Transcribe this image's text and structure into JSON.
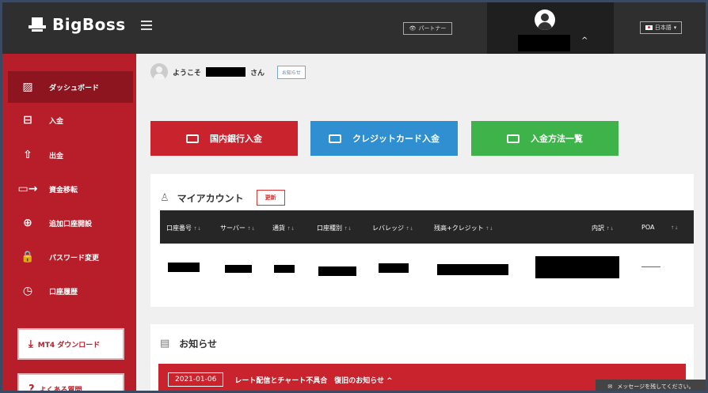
{
  "header": {
    "brand": "BigBoss",
    "partner_label": "パートナー",
    "language_label": "日本語"
  },
  "sidebar": {
    "items": [
      {
        "label": "ダッシュボード",
        "icon": "chart-icon"
      },
      {
        "label": "入金",
        "icon": "deposit-icon"
      },
      {
        "label": "出金",
        "icon": "withdraw-icon"
      },
      {
        "label": "資金移転",
        "icon": "transfer-icon"
      },
      {
        "label": "追加口座開設",
        "icon": "add-account-icon"
      },
      {
        "label": "パスワード変更",
        "icon": "lock-icon"
      },
      {
        "label": "口座履歴",
        "icon": "history-icon"
      }
    ],
    "mt4_download": "MT4 ダウンロード",
    "faq": "よくある質問"
  },
  "welcome": {
    "prefix": "ようこそ",
    "suffix": "さん",
    "notice_tag": "お知らせ"
  },
  "deposit_buttons": {
    "domestic_bank": "国内銀行入金",
    "credit_card": "クレジットカード入金",
    "methods_list": "入金方法一覧"
  },
  "account_card": {
    "title": "マイアカウント",
    "update_label": "更新",
    "columns": [
      "口座番号",
      "サーバー",
      "通貨",
      "口座種別",
      "レバレッジ",
      "残高+クレジット",
      "内訳",
      "POA"
    ],
    "sort_glyph": "↑↓",
    "row_poa": "—"
  },
  "news_card": {
    "title": "お知らせ",
    "date": "2021-01-06",
    "headline": "レート配信とチャート不具合　復旧のお知らせ ^"
  },
  "chat": {
    "label": "メッセージを残してください。"
  },
  "colors": {
    "sidebar_red": "#b81e2a",
    "topbar": "#2f2f2f",
    "bank_red": "#c9232d",
    "card_blue": "#2f8fd0",
    "methods_green": "#3eb34a"
  }
}
